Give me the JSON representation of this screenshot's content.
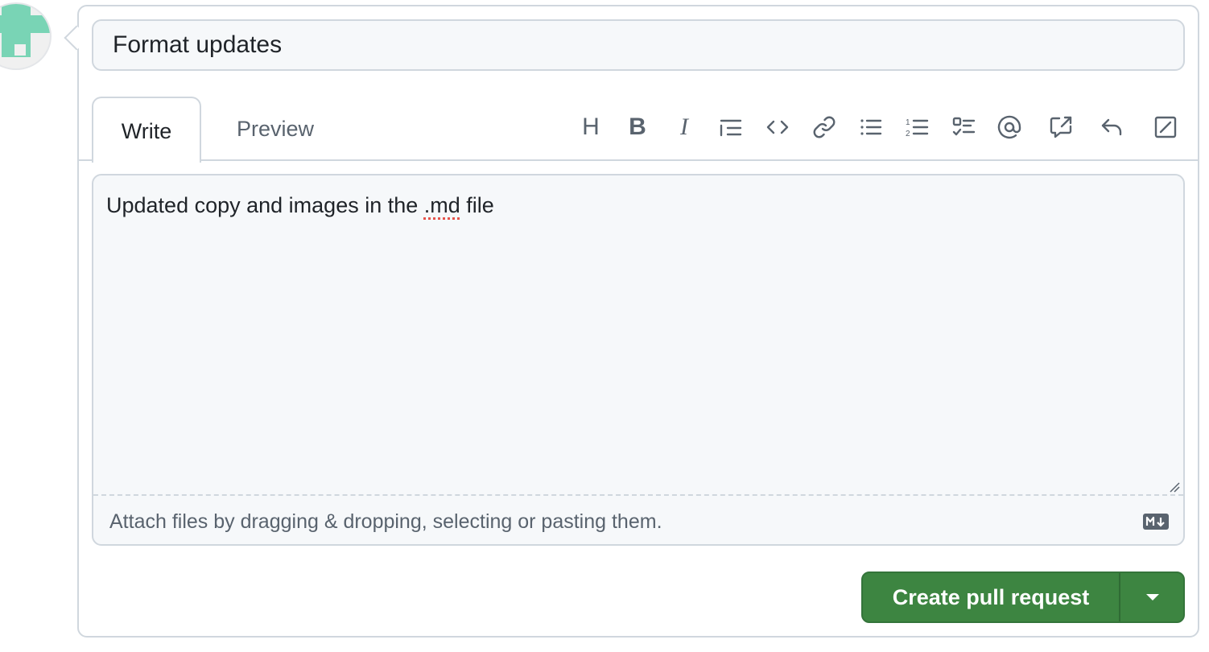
{
  "title_field": {
    "value": "Format updates"
  },
  "tabs": [
    {
      "label": "Write",
      "selected": true
    },
    {
      "label": "Preview",
      "selected": false
    }
  ],
  "toolbar": {
    "icons": [
      "heading-icon",
      "bold-icon",
      "italic-icon",
      "quote-icon",
      "code-icon",
      "link-icon",
      "bulleted-list-icon",
      "numbered-list-icon",
      "task-list-icon",
      "mention-icon",
      "reference-icon",
      "reply-icon",
      "fullscreen-icon"
    ],
    "heading_label": "H",
    "bold_label": "B",
    "italic_label": "I"
  },
  "body": {
    "text_before": "Updated copy and images in the ",
    "misspelled_word": ".md",
    "text_after": " file",
    "attach_hint": "Attach files by dragging & dropping, selecting or pasting them."
  },
  "actions": {
    "submit_label": "Create pull request",
    "colors": {
      "button": "#3d8541",
      "accent": "#79d4b5"
    }
  }
}
